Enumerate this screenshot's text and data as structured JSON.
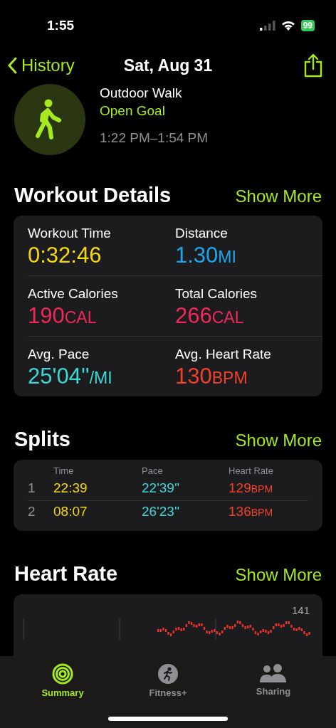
{
  "status_bar": {
    "time": "1:55",
    "battery": "99"
  },
  "nav": {
    "back": "History",
    "title": "Sat, Aug 31"
  },
  "workout": {
    "name": "Outdoor Walk",
    "goal": "Open Goal",
    "time_range": "1:22 PM–1:54 PM"
  },
  "details": {
    "title": "Workout Details",
    "more": "Show More",
    "metrics": [
      {
        "label": "Workout Time",
        "value": "0:32:46",
        "color": "#f5d90a"
      },
      {
        "label": "Distance",
        "value": "1.30",
        "unit": "MI",
        "color": "#1ba7f0"
      },
      {
        "label": "Active Calories",
        "value": "190",
        "unit": "CAL",
        "color": "#f2275a"
      },
      {
        "label": "Total Calories",
        "value": "266",
        "unit": "CAL",
        "color": "#f2275a"
      },
      {
        "label": "Avg. Pace",
        "value": "25'04''",
        "unit": "/MI",
        "color": "#3cd8d8"
      },
      {
        "label": "Avg. Heart Rate",
        "value": "130",
        "unit": "BPM",
        "color": "#f2402a"
      }
    ]
  },
  "splits": {
    "title": "Splits",
    "more": "Show More",
    "columns": [
      "Time",
      "Pace",
      "Heart Rate"
    ],
    "rows": [
      {
        "index": "1",
        "time": "22:39",
        "pace": "22'39''",
        "heart_rate": "129",
        "unit": "BPM"
      },
      {
        "index": "2",
        "time": "08:07",
        "pace": "26'23''",
        "heart_rate": "136",
        "unit": "BPM"
      }
    ]
  },
  "heart_rate": {
    "title": "Heart Rate",
    "more": "Show More",
    "max_label": "141"
  },
  "tab_bar": [
    {
      "label": "Summary",
      "kind": "rings",
      "selected": true
    },
    {
      "label": "Fitness+",
      "kind": "runner",
      "selected": false
    },
    {
      "label": "Sharing",
      "kind": "people",
      "selected": false
    }
  ]
}
